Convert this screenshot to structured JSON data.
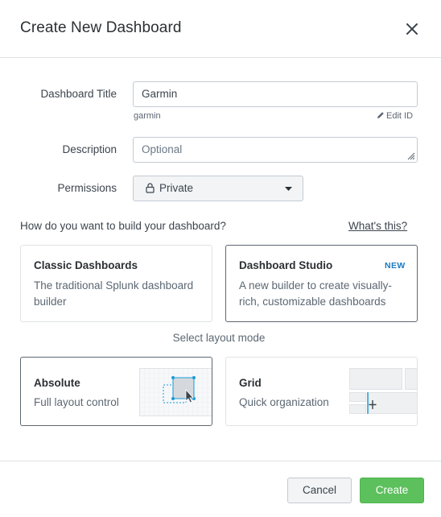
{
  "dialog": {
    "title": "Create New Dashboard"
  },
  "form": {
    "title_label": "Dashboard Title",
    "title_value": "Garmin",
    "dashboard_id": "garmin",
    "edit_id_label": "Edit ID",
    "description_label": "Description",
    "description_placeholder": "Optional",
    "permissions_label": "Permissions",
    "permissions_value": "Private"
  },
  "build": {
    "question": "How do you want to build your dashboard?",
    "help_link": "What's this?",
    "options": [
      {
        "title": "Classic Dashboards",
        "description": "The traditional Splunk dashboard builder",
        "selected": false
      },
      {
        "title": "Dashboard Studio",
        "badge": "NEW",
        "description": "A new builder to create visually-rich, customizable dashboards",
        "selected": true
      }
    ]
  },
  "layout": {
    "heading": "Select layout mode",
    "options": [
      {
        "title": "Absolute",
        "description": "Full layout control",
        "selected": true
      },
      {
        "title": "Grid",
        "description": "Quick organization",
        "selected": false
      }
    ]
  },
  "footer": {
    "cancel_label": "Cancel",
    "create_label": "Create"
  },
  "colors": {
    "primary_button": "#5cc05c",
    "new_badge": "#1a7ac2",
    "selected_border": "#5c6773",
    "accent_handles": "#1a9bd7"
  },
  "icons": {
    "close": "close-icon",
    "edit": "pencil-icon",
    "lock": "lock-icon",
    "dropdown": "caret-down-icon",
    "resize": "resize-grip-icon"
  }
}
